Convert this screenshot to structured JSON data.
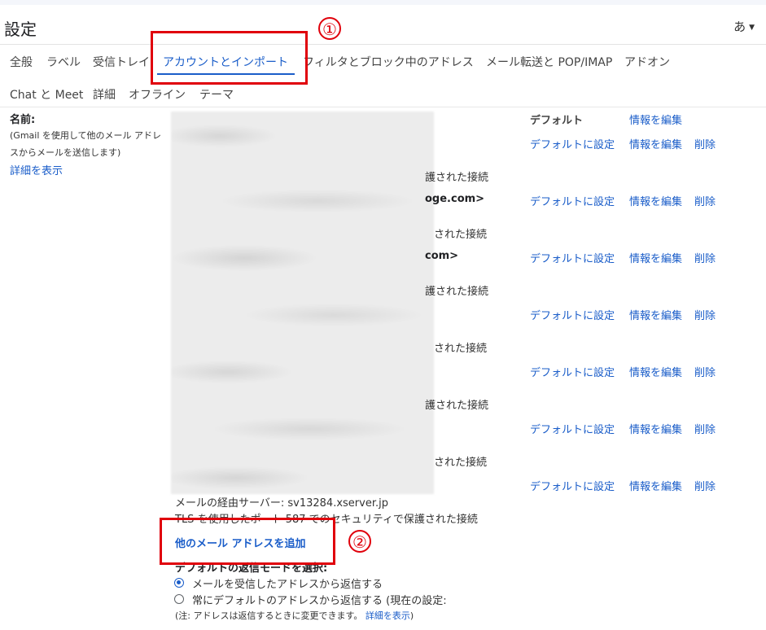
{
  "header": {
    "title": "設定",
    "input_tools": "あ"
  },
  "tabs_row1": [
    {
      "label": "全般"
    },
    {
      "label": "ラベル"
    },
    {
      "label": "受信トレイ"
    },
    {
      "label": "アカウントとインポート",
      "active": true
    },
    {
      "label": "フィルタとブロック中のアドレス"
    },
    {
      "label": "メール転送と POP/IMAP"
    },
    {
      "label": "アドオン"
    }
  ],
  "tabs_row2": [
    {
      "label": "Chat と Meet"
    },
    {
      "label": "詳細"
    },
    {
      "label": "オフライン"
    },
    {
      "label": "テーマ"
    }
  ],
  "section": {
    "label": "名前:",
    "desc1": "(Gmail を使用して他のメール アドレ",
    "desc2": "スからメールを送信します)",
    "details_link": "詳細を表示"
  },
  "partials": {
    "tls_tail": "護された接続",
    "tls_tail2": "された接続",
    "addr1_tail": "oge.com>",
    "addr2_tail": "com>"
  },
  "actions": {
    "default_label": "デフォルト",
    "set_default": "デフォルトに設定",
    "edit": "情報を編集",
    "delete": "削除"
  },
  "footer": {
    "server": "メールの経由サーバー: sv13284.xserver.jp",
    "tls_line": "TLS を使用したポート 587 でのセキュリティで保護された接続",
    "add_link": "他のメール アドレスを追加",
    "reply_mode": "デフォルトの返信モードを選択:",
    "radio1": "メールを受信したアドレスから返信する",
    "radio2": "常にデフォルトのアドレスから返信する (現在の設定:",
    "note": "(注: アドレスは返信するときに変更できます。",
    "note_link": "詳細を表示",
    "note_close": ")"
  },
  "annotations": {
    "one": "①",
    "two": "②"
  },
  "colors": {
    "link": "#1a5dc9",
    "annotation": "#e0000b"
  }
}
